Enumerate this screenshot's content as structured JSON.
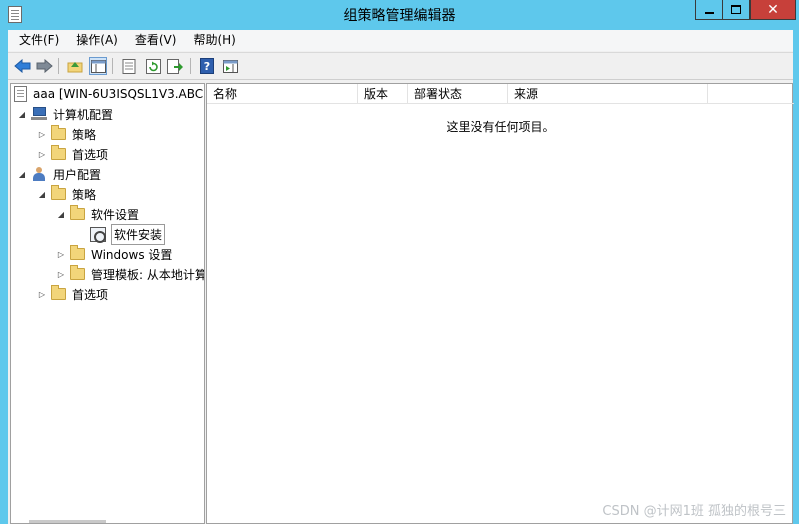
{
  "window": {
    "title": "组策略管理编辑器",
    "close_glyph": "✕"
  },
  "menu": [
    "文件(F)",
    "操作(A)",
    "查看(V)",
    "帮助(H)"
  ],
  "toolbar": {
    "back_icon": "back-arrow-icon",
    "forward_icon": "forward-arrow-icon",
    "up_icon": "up-folder-icon",
    "tree_toggle_icon": "show-hide-tree-icon",
    "properties_icon": "properties-icon",
    "refresh_icon": "refresh-icon",
    "export_icon": "export-list-icon",
    "help_icon": "help-icon",
    "help_glyph": "?",
    "view_icon": "view-icon"
  },
  "tree": {
    "root": "aaa [WIN-6U3ISQSL1V3.ABC",
    "computer_config": "计算机配置",
    "policies": "策略",
    "preferences": "首选项",
    "user_config": "用户配置",
    "software_settings": "软件设置",
    "software_install": "软件安装",
    "windows_settings": "Windows 设置",
    "admin_templates": "管理模板: 从本地计算",
    "expanded_arrow": "◢",
    "collapsed_arrow": "▷"
  },
  "list": {
    "columns": [
      "名称",
      "版本",
      "部署状态",
      "来源"
    ],
    "empty_message": "这里没有任何项目。"
  },
  "watermark": "CSDN @计网1班  孤独的根号三",
  "colors": {
    "titlebar": "#5ec8ec",
    "close_button": "#c7403a",
    "folder": "#f2d57a"
  }
}
